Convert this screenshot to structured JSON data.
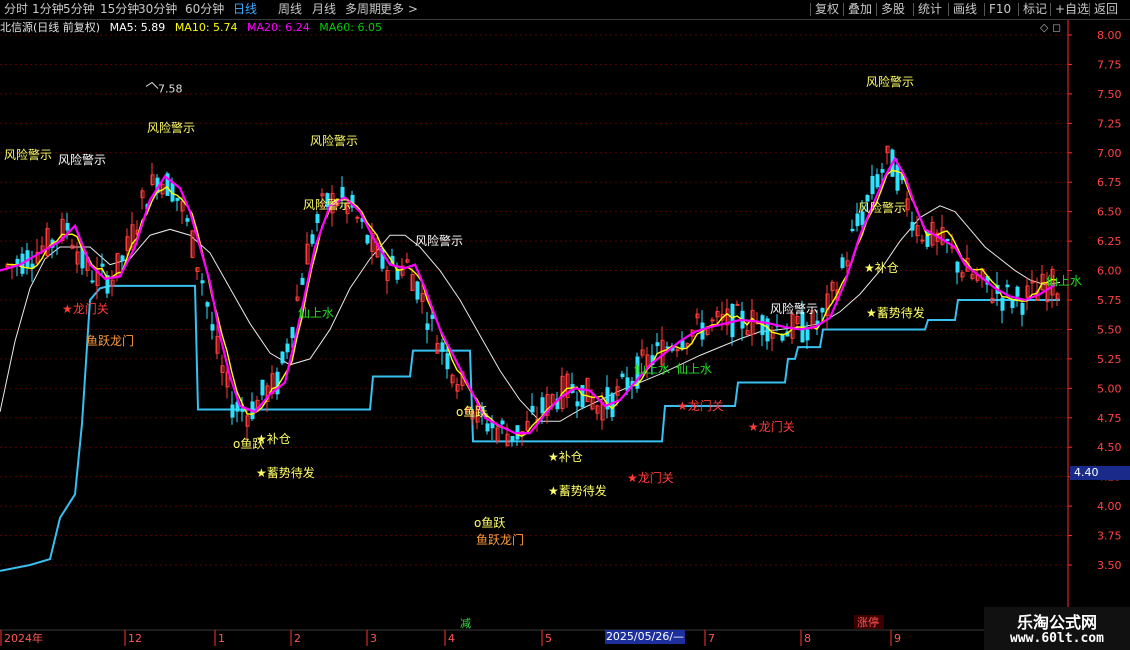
{
  "toolbar": {
    "left": [
      "分时",
      "1分钟",
      "5分钟",
      "15分钟",
      "30分钟",
      "60分钟",
      "日线",
      "周线",
      "月线",
      "多周期",
      "更多 >"
    ],
    "active": "日线",
    "right": [
      "复权",
      "叠加",
      "多股",
      "统计",
      "画线",
      "F10",
      "标记",
      "+自选",
      "返回"
    ]
  },
  "info": {
    "title": "北信源(日线 前复权)",
    "ma5": "MA5: 5.89",
    "ma10": "MA10: 5.74",
    "ma20": "MA20: 6.24",
    "ma60": "MA60: 6.05",
    "icons": "◇ ◻"
  },
  "colors": {
    "ma5": "#ffffff",
    "ma10": "#ffff00",
    "ma20": "#ff00ff",
    "ma60": "#00cc00",
    "support": "#38c0f0",
    "up": "#ff3b3b",
    "down": "#30e0ff",
    "grid": "#5a0000",
    "axis": "#ff2d2d"
  },
  "chart_data": {
    "type": "candlestick",
    "ylim": [
      3.5,
      8.0
    ],
    "yticks": [
      "8.00",
      "7.75",
      "7.50",
      "7.25",
      "7.00",
      "6.75",
      "6.50",
      "6.25",
      "6.00",
      "5.75",
      "5.50",
      "5.25",
      "5.00",
      "4.75",
      "4.50",
      "4.25",
      "4.00",
      "3.75",
      "3.50"
    ],
    "xticks": [
      "2024年",
      "12",
      "1",
      "2",
      "3",
      "4",
      "5",
      "2025/05/26/—",
      "7",
      "8",
      "9"
    ],
    "current_price": "4.40",
    "max_label": "7.58",
    "bottom_tags": [
      "减",
      "涨停"
    ],
    "annotations": [
      {
        "text": "风险警示",
        "color": "#ffff66"
      },
      {
        "text": "风险警示",
        "color": "#ffffff"
      },
      {
        "text": "风险警示",
        "color": "#ffff66"
      },
      {
        "text": "风险警示",
        "color": "#ffff66"
      },
      {
        "text": "风险警示",
        "color": "#ffff66"
      },
      {
        "text": "风险警示",
        "color": "#ffffff"
      },
      {
        "text": "风险警示",
        "color": "#ffffff"
      },
      {
        "text": "风险警示",
        "color": "#ffff66"
      },
      {
        "text": "风险警示",
        "color": "#ffff66"
      },
      {
        "text": "★龙门关",
        "color": "#ff3b3b"
      },
      {
        "text": "鱼跃龙门",
        "color": "#ff9a3b"
      },
      {
        "text": "o鱼跃",
        "color": "#ffff66"
      },
      {
        "text": "★补仓",
        "color": "#ffff66"
      },
      {
        "text": "★蓄势待发",
        "color": "#ffff66"
      },
      {
        "text": "仙上水",
        "color": "#22dd22"
      },
      {
        "text": "o鱼跃",
        "color": "#ffff66"
      },
      {
        "text": "o鱼跃",
        "color": "#ffff66"
      },
      {
        "text": "鱼跃龙门",
        "color": "#ff9a3b"
      },
      {
        "text": "★补仓",
        "color": "#ffff66"
      },
      {
        "text": "★蓄势待发",
        "color": "#ffff66"
      },
      {
        "text": "★龙门关",
        "color": "#ff3b3b"
      },
      {
        "text": "仙上水",
        "color": "#22dd22"
      },
      {
        "text": "仙上水",
        "color": "#22dd22"
      },
      {
        "text": "★龙门关",
        "color": "#ff3b3b"
      },
      {
        "text": "★龙门关",
        "color": "#ff3b3b"
      },
      {
        "text": "★补仓",
        "color": "#ffff66"
      },
      {
        "text": "★蓄势待发",
        "color": "#ffff66"
      },
      {
        "text": "仙上水",
        "color": "#22dd22"
      }
    ],
    "ma20_points": [
      [
        0,
        6.0
      ],
      [
        20,
        6.05
      ],
      [
        40,
        6.15
      ],
      [
        60,
        6.25
      ],
      [
        75,
        6.38
      ],
      [
        90,
        6.05
      ],
      [
        105,
        5.93
      ],
      [
        120,
        5.95
      ],
      [
        135,
        6.2
      ],
      [
        150,
        6.6
      ],
      [
        165,
        6.8
      ],
      [
        180,
        6.7
      ],
      [
        190,
        6.5
      ],
      [
        200,
        6.2
      ],
      [
        210,
        5.9
      ],
      [
        220,
        5.45
      ],
      [
        230,
        5.1
      ],
      [
        240,
        4.85
      ],
      [
        255,
        4.8
      ],
      [
        270,
        4.95
      ],
      [
        285,
        5.05
      ],
      [
        300,
        5.6
      ],
      [
        315,
        6.2
      ],
      [
        330,
        6.55
      ],
      [
        345,
        6.62
      ],
      [
        360,
        6.5
      ],
      [
        375,
        6.25
      ],
      [
        390,
        6.05
      ],
      [
        405,
        6.02
      ],
      [
        415,
        6.05
      ],
      [
        425,
        5.85
      ],
      [
        440,
        5.5
      ],
      [
        455,
        5.25
      ],
      [
        470,
        5.0
      ],
      [
        485,
        4.75
      ],
      [
        500,
        4.68
      ],
      [
        515,
        4.62
      ],
      [
        530,
        4.62
      ],
      [
        545,
        4.78
      ],
      [
        560,
        4.92
      ],
      [
        575,
        5.0
      ],
      [
        590,
        4.98
      ],
      [
        605,
        4.85
      ],
      [
        620,
        4.9
      ],
      [
        635,
        5.05
      ],
      [
        650,
        5.2
      ],
      [
        665,
        5.3
      ],
      [
        680,
        5.4
      ],
      [
        695,
        5.48
      ],
      [
        710,
        5.52
      ],
      [
        725,
        5.55
      ],
      [
        740,
        5.58
      ],
      [
        755,
        5.57
      ],
      [
        770,
        5.55
      ],
      [
        785,
        5.52
      ],
      [
        800,
        5.5
      ],
      [
        815,
        5.52
      ],
      [
        830,
        5.6
      ],
      [
        845,
        5.9
      ],
      [
        860,
        6.3
      ],
      [
        875,
        6.6
      ],
      [
        885,
        6.8
      ],
      [
        895,
        6.95
      ],
      [
        905,
        6.8
      ],
      [
        915,
        6.55
      ],
      [
        925,
        6.35
      ],
      [
        935,
        6.3
      ],
      [
        945,
        6.25
      ],
      [
        955,
        6.2
      ],
      [
        965,
        6.05
      ],
      [
        980,
        5.95
      ],
      [
        995,
        5.85
      ],
      [
        1010,
        5.78
      ],
      [
        1025,
        5.75
      ],
      [
        1040,
        5.8
      ],
      [
        1055,
        5.88
      ]
    ],
    "ma60_points": [
      [
        0,
        4.8
      ],
      [
        15,
        5.4
      ],
      [
        30,
        5.85
      ],
      [
        45,
        6.1
      ],
      [
        60,
        6.2
      ],
      [
        75,
        6.2
      ],
      [
        90,
        6.2
      ],
      [
        110,
        6.05
      ],
      [
        130,
        6.1
      ],
      [
        150,
        6.3
      ],
      [
        170,
        6.35
      ],
      [
        190,
        6.3
      ],
      [
        210,
        6.15
      ],
      [
        230,
        5.85
      ],
      [
        250,
        5.55
      ],
      [
        270,
        5.3
      ],
      [
        290,
        5.2
      ],
      [
        310,
        5.25
      ],
      [
        330,
        5.5
      ],
      [
        350,
        5.85
      ],
      [
        370,
        6.1
      ],
      [
        390,
        6.3
      ],
      [
        405,
        6.3
      ],
      [
        420,
        6.2
      ],
      [
        440,
        6.0
      ],
      [
        460,
        5.75
      ],
      [
        480,
        5.45
      ],
      [
        500,
        5.15
      ],
      [
        520,
        4.9
      ],
      [
        540,
        4.72
      ],
      [
        560,
        4.72
      ],
      [
        580,
        4.82
      ],
      [
        600,
        4.9
      ],
      [
        620,
        4.98
      ],
      [
        640,
        5.05
      ],
      [
        660,
        5.12
      ],
      [
        680,
        5.2
      ],
      [
        700,
        5.28
      ],
      [
        720,
        5.35
      ],
      [
        740,
        5.42
      ],
      [
        760,
        5.48
      ],
      [
        780,
        5.5
      ],
      [
        800,
        5.52
      ],
      [
        820,
        5.55
      ],
      [
        840,
        5.65
      ],
      [
        860,
        5.8
      ],
      [
        880,
        6.0
      ],
      [
        900,
        6.25
      ],
      [
        920,
        6.45
      ],
      [
        940,
        6.55
      ],
      [
        955,
        6.5
      ],
      [
        970,
        6.35
      ],
      [
        985,
        6.2
      ],
      [
        1000,
        6.1
      ],
      [
        1015,
        6.0
      ],
      [
        1030,
        5.92
      ],
      [
        1045,
        5.88
      ],
      [
        1060,
        5.9
      ]
    ],
    "support_points": [
      [
        0,
        3.45
      ],
      [
        30,
        3.5
      ],
      [
        50,
        3.55
      ],
      [
        60,
        3.9
      ],
      [
        75,
        4.1
      ],
      [
        82,
        4.7
      ],
      [
        90,
        5.75
      ],
      [
        100,
        5.85
      ],
      [
        110,
        5.87
      ],
      [
        195,
        5.87
      ],
      [
        198,
        4.82
      ],
      [
        370,
        4.82
      ],
      [
        373,
        5.1
      ],
      [
        410,
        5.1
      ],
      [
        413,
        5.32
      ],
      [
        470,
        5.32
      ],
      [
        473,
        4.55
      ],
      [
        662,
        4.55
      ],
      [
        665,
        4.85
      ],
      [
        735,
        4.85
      ],
      [
        738,
        5.05
      ],
      [
        785,
        5.05
      ],
      [
        788,
        5.25
      ],
      [
        795,
        5.25
      ],
      [
        798,
        5.35
      ],
      [
        820,
        5.35
      ],
      [
        823,
        5.5
      ],
      [
        925,
        5.5
      ],
      [
        928,
        5.58
      ],
      [
        955,
        5.58
      ],
      [
        958,
        5.75
      ],
      [
        1060,
        5.75
      ]
    ]
  }
}
